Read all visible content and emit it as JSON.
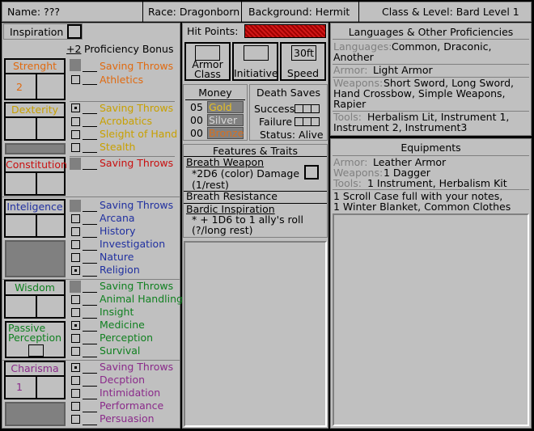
{
  "top": {
    "name": "Name: ???",
    "race": "Race: Dragonborn",
    "background": "Background: Hermit",
    "class_level": "Class & Level: Bard Level 1"
  },
  "inspiration": "Inspiration",
  "proficiency": {
    "value": "+2",
    "label": "Proficiency Bonus"
  },
  "abilities": {
    "strength": {
      "name": "Strenght",
      "score": "2",
      "skills": [
        "Saving Throws",
        "Athletics"
      ]
    },
    "dexterity": {
      "name": "Dexterity",
      "skills": [
        "Saving Throws",
        "Acrobatics",
        "Sleight of Hand",
        "Stealth"
      ]
    },
    "constitution": {
      "name": "Constitution",
      "skills": [
        "Saving Throws"
      ]
    },
    "intelligence": {
      "name": "Inteligence",
      "skills": [
        "Saving Throws",
        "Arcana",
        "History",
        "Investigation",
        "Nature",
        "Religion"
      ]
    },
    "wisdom": {
      "name": "Wisdom",
      "skills": [
        "Saving Throws",
        "Animal Handling",
        "Insight",
        "Medicine",
        "Perception",
        "Survival"
      ],
      "passive": "Passive Perception"
    },
    "charisma": {
      "name": "Charisma",
      "score": "1",
      "skills": [
        "Saving Throws",
        "Decption",
        "Intimidation",
        "Performance",
        "Persuasion"
      ]
    }
  },
  "hp": {
    "label": "Hit Points:"
  },
  "combat": {
    "armor": "Armor Class",
    "initiative": "Initiative",
    "speed_value": "30ft",
    "speed": "Speed"
  },
  "money": {
    "title": "Money",
    "gold_n": "05",
    "gold": "Gold",
    "silver_n": "00",
    "silver": "Silver",
    "bronze_n": "00",
    "bronze": "Bronze"
  },
  "death": {
    "title": "Death Saves",
    "success": "Success",
    "failure": "Failure",
    "status": "Status: Alive"
  },
  "features": {
    "title": "Features & Traits",
    "breath_weapon": "Breath Weapon",
    "bw_line1": "*2D6 (color) Damage",
    "bw_line2": "(1/rest)",
    "breath_resistance": "Breath Resistance",
    "bardic": "Bardic Inspiration",
    "bi_line1": "* + 1D6 to 1 ally's roll",
    "bi_line2": "(?/long rest)"
  },
  "languages": {
    "title": "Languages & Other Proficiencies",
    "lang_label": "Languages:",
    "lang_line1": "Common, Draconic,",
    "lang_line2": "Another",
    "armor_label": "Armor:",
    "armor": "Light Armor",
    "weapons_label": "Weapons:",
    "weapons_line1": "Short Sword, Long Sword,",
    "weapons_line2": "Hand Crossbow, Simple Weapons,",
    "weapons_line3": "Rapier",
    "tools_label": "Tools:",
    "tools_line1": "Herbalism Lit, Instrument 1,",
    "tools_line2": "Instrument 2, Instrument3"
  },
  "equipment": {
    "title": "Equipments",
    "armor_label": "Armor:",
    "armor": "Leather Armor",
    "weapons_label": "Weapons:",
    "weapons": "1 Dagger",
    "tools_label": "Tools:",
    "tools": "1 Instrument, Herbalism Kit",
    "line1": "1 Scroll Case full with your notes,",
    "line2": "1 Winter Blanket, Common Clothes"
  },
  "colors": {
    "strength": "#e06a10",
    "dexterity": "#c8a000",
    "constitution": "#c81010",
    "intelligence": "#2030a0",
    "wisdom": "#108020",
    "charisma": "#8a2a8a",
    "panel": "#c0c0c0"
  }
}
